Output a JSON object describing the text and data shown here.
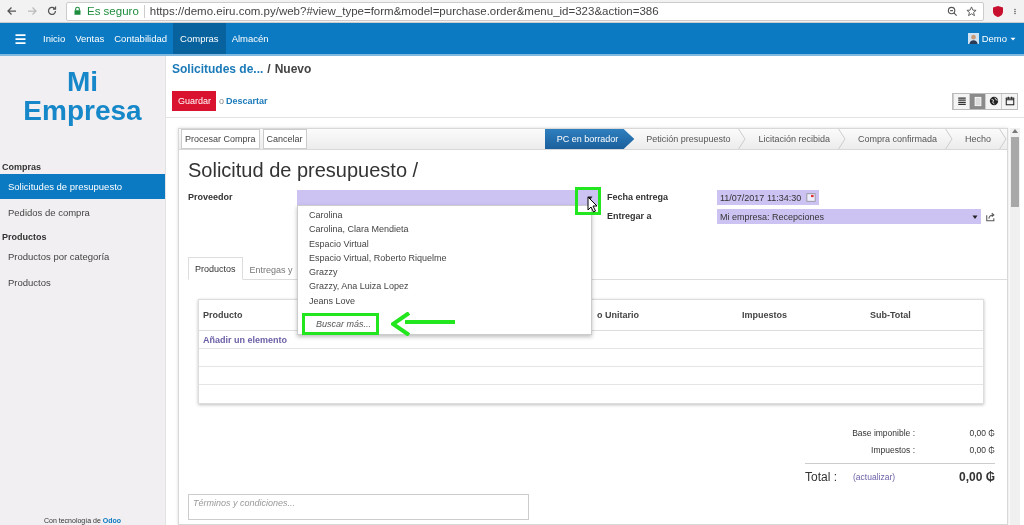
{
  "browser": {
    "security": "Es seguro",
    "url": "https://demo.eiru.com.py/web?#view_type=form&model=purchase.order&menu_id=323&action=386"
  },
  "navbar": {
    "items": [
      {
        "label": "Inicio",
        "selected": false
      },
      {
        "label": "Ventas",
        "selected": false
      },
      {
        "label": "Contabilidad",
        "selected": false
      },
      {
        "label": "Compras",
        "selected": true
      },
      {
        "label": "Almacén",
        "selected": false
      }
    ],
    "user": "Demo"
  },
  "sidebar": {
    "logo": [
      "Mi",
      "Empresa"
    ],
    "sections": [
      {
        "title": "Compras",
        "items": [
          {
            "label": "Solicitudes de presupuesto",
            "selected": true
          },
          {
            "label": "Pedidos de compra",
            "selected": false
          }
        ]
      },
      {
        "title": "Productos",
        "items": [
          {
            "label": "Productos por categoría",
            "selected": false
          },
          {
            "label": "Productos",
            "selected": false
          }
        ]
      }
    ],
    "footer": {
      "text": "Con tecnología de",
      "link": "Odoo"
    }
  },
  "breadcrumb": {
    "parent": "Solicitudes de...",
    "separator": "/",
    "current": "Nuevo"
  },
  "actions": {
    "save": "Guardar",
    "or": "o",
    "discard": "Descartar"
  },
  "view_switcher": [
    {
      "kind": "list",
      "selected": false
    },
    {
      "kind": "form",
      "selected": true
    },
    {
      "kind": "map",
      "selected": false
    },
    {
      "kind": "calendar",
      "selected": false
    }
  ],
  "form": {
    "buttons": [
      "Procesar Compra",
      "Cancelar"
    ],
    "stages": [
      {
        "label": "PC en borrador",
        "selected": true
      },
      {
        "label": "Petición presupuesto",
        "selected": false
      },
      {
        "label": "Licitación recibida",
        "selected": false
      },
      {
        "label": "Compra confirmada",
        "selected": false
      },
      {
        "label": "Hecho",
        "selected": false
      }
    ],
    "title": "Solicitud de presupuesto /",
    "supplier": {
      "label": "Proveedor",
      "expanded": true,
      "options": [
        "Carolina",
        "Carolina, Clara Mendieta",
        "Espacio Virtual",
        "Espacio Virtual, Roberto Riquelme",
        "Grazzy",
        "Grazzy, Ana Luiza Lopez",
        "Jeans Love"
      ],
      "search_more": "Buscar más..."
    },
    "delivery_date": {
      "label": "Fecha entrega",
      "value": "11/07/2017 11:34:30"
    },
    "deliver_to": {
      "label": "Entregar a",
      "value": "Mi empresa: Recepciones"
    },
    "tabs": [
      {
        "label": "Productos",
        "selected": true
      },
      {
        "label": "Entregas y",
        "selected": false
      }
    ],
    "lines": {
      "columns": [
        "Producto",
        "o Unitario",
        "Impuestos",
        "Sub-Total"
      ],
      "add_item": "Añadir un elemento"
    },
    "totals": [
      {
        "label": "Base imponible :",
        "value": "0,00 ₲"
      },
      {
        "label": "Impuestos :",
        "value": "0,00 ₲"
      }
    ],
    "total": {
      "label": "Total :",
      "update": "(actualizar)",
      "value": "0,00 ₲"
    },
    "notes": {
      "placeholder": "Términos y condiciones..."
    }
  }
}
